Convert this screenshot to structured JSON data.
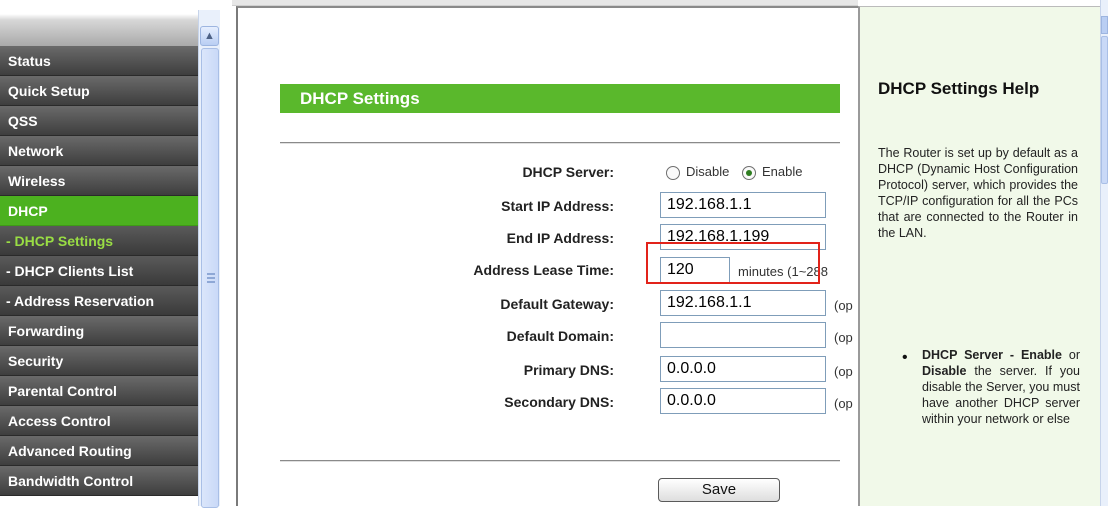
{
  "menu": {
    "items": [
      {
        "label": "Status"
      },
      {
        "label": "Quick Setup"
      },
      {
        "label": "QSS"
      },
      {
        "label": "Network"
      },
      {
        "label": "Wireless"
      },
      {
        "label": "DHCP"
      },
      {
        "label": "- DHCP Settings"
      },
      {
        "label": "- DHCP Clients List"
      },
      {
        "label": "- Address Reservation"
      },
      {
        "label": "Forwarding"
      },
      {
        "label": "Security"
      },
      {
        "label": "Parental Control"
      },
      {
        "label": "Access Control"
      },
      {
        "label": "Advanced Routing"
      },
      {
        "label": "Bandwidth Control"
      }
    ],
    "active_item": "DHCP",
    "current_subitem": "- DHCP Settings",
    "scroll_up_glyph": "▲"
  },
  "main": {
    "header": "DHCP Settings",
    "dhcp_server": {
      "label": "DHCP Server:",
      "options": [
        "Disable",
        "Enable"
      ],
      "selected": "Enable"
    },
    "start_ip": {
      "label": "Start IP Address:",
      "value": "192.168.1.1"
    },
    "end_ip": {
      "label": "End IP Address:",
      "value": "192.168.1.199"
    },
    "lease_time": {
      "label": "Address Lease Time:",
      "value": "120",
      "hint": "minutes (1~288"
    },
    "gateway": {
      "label": "Default Gateway:",
      "value": "192.168.1.1",
      "hint": "(op"
    },
    "domain": {
      "label": "Default Domain:",
      "value": "",
      "hint": "(op"
    },
    "primary_dns": {
      "label": "Primary DNS:",
      "value": "0.0.0.0",
      "hint": "(op"
    },
    "secondary_dns": {
      "label": "Secondary DNS:",
      "value": "0.0.0.0",
      "hint": "(op"
    },
    "save_label": "Save"
  },
  "help": {
    "title": "DHCP Settings Help",
    "paragraph": "The Router is set up by default as a DHCP (Dynamic Host Configuration Protocol) server, which provides the TCP/IP configuration for all the PCs that are connected to the Router in the LAN.",
    "bullet_title": "DHCP Server -",
    "bullet_opt1": "Enable",
    "bullet_or": "or",
    "bullet_opt2": "Disable",
    "bullet_text": "the server. If you disable the Server, you must have another DHCP server within your network or else"
  },
  "colors": {
    "accent_green": "#5ab82c",
    "menu_dark": "#3e3e3e",
    "current_subitem_text": "#99dd44",
    "help_background": "#f1f9e9",
    "highlight_border": "#e2231a"
  },
  "icons": {
    "menu_scroll_up": "arrow-up-icon",
    "menu_scroll_grip": "grip-icon",
    "radio": "radio-icon"
  }
}
